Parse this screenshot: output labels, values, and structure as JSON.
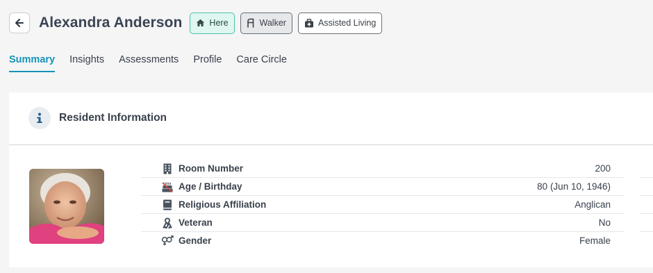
{
  "header": {
    "resident_name": "Alexandra Anderson",
    "chips": [
      {
        "label": "Here",
        "icon": "home-icon"
      },
      {
        "label": "Walker",
        "icon": "walker-icon"
      },
      {
        "label": "Assisted Living",
        "icon": "medical-kit-icon"
      }
    ]
  },
  "tabs": [
    {
      "label": "Summary",
      "active": true
    },
    {
      "label": "Insights"
    },
    {
      "label": "Assessments"
    },
    {
      "label": "Profile"
    },
    {
      "label": "Care Circle"
    }
  ],
  "card": {
    "title": "Resident Information",
    "icon": "info-icon",
    "rows": [
      {
        "label": "Room Number",
        "value": "200",
        "icon": "building-icon"
      },
      {
        "label": "Age / Birthday",
        "value": "80 (Jun 10, 1946)",
        "icon": "cake-icon"
      },
      {
        "label": "Religious Affiliation",
        "value": "Anglican",
        "icon": "book-icon"
      },
      {
        "label": "Veteran",
        "value": "No",
        "icon": "ribbon-icon"
      },
      {
        "label": "Gender",
        "value": "Female",
        "icon": "gender-icon"
      }
    ]
  },
  "colors": {
    "accent": "#1593b6",
    "here_chip_bg": "#dff6f1",
    "here_chip_border": "#4fc1a9",
    "page_bg": "#f5f5f6"
  }
}
